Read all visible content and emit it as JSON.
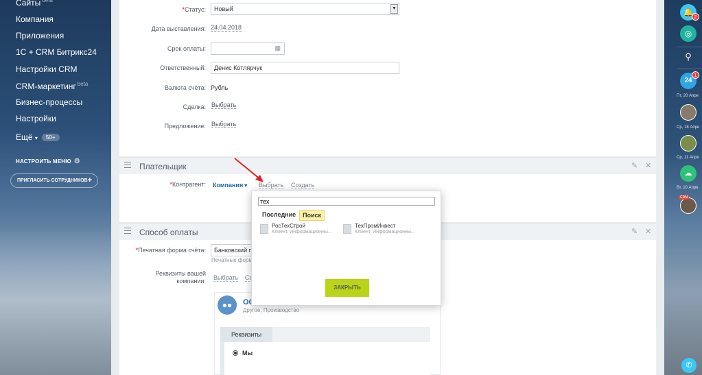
{
  "sidebar": {
    "items": [
      {
        "label": "Сайты",
        "sup": "beta"
      },
      {
        "label": "Компания"
      },
      {
        "label": "Приложения"
      },
      {
        "label": "1С + CRM Битрикс24"
      },
      {
        "label": "Настройки CRM"
      },
      {
        "label": "CRM-маркетинг",
        "sup": "beta"
      },
      {
        "label": "Бизнес-процессы"
      },
      {
        "label": "Настройки"
      },
      {
        "label": "Ещё",
        "badge": "50+"
      }
    ],
    "configure_menu": "НАСТРОИТЬ МЕНЮ",
    "invite": "ПРИГЛАСИТЬ СОТРУДНИКОВ"
  },
  "form": {
    "status_label": "Статус:",
    "status_value": "Новый",
    "date_label": "Дата выставления:",
    "date_value": "24.04.2018",
    "due_label": "Срок оплаты:",
    "due_value": "",
    "responsible_label": "Ответственный:",
    "responsible_value": "Денис Котлярчук",
    "currency_label": "Валюта счёта:",
    "currency_value": "Рубль",
    "deal_label": "Сделка:",
    "deal_link": "Выбрать",
    "offer_label": "Предложение:",
    "offer_link": "Выбрать"
  },
  "payer": {
    "title": "Плательщик",
    "contractor_label": "Контрагент:",
    "company": "Компания",
    "choose": "Выбрать",
    "create": "Создать"
  },
  "payment": {
    "title": "Способ оплаты",
    "print_label": "Печатная форма счёта:",
    "print_value": "Банковский пе",
    "print_hint": "Печатные форм",
    "requisites_label_1": "Реквизиты вашей",
    "requisites_label_2": "компании:",
    "requisites_choose": "Выбрать",
    "requisites_create": "Со"
  },
  "org": {
    "name": "ОО",
    "subtitle": "Другое, Производство",
    "tab": "Реквизиты",
    "radio_label": "Мы"
  },
  "popup": {
    "search_value": "тех",
    "tab_recent": "Последние",
    "tab_search": "Поиск",
    "results": [
      {
        "name": "РосТехСтрой",
        "sub": "Клиент, Информационны..."
      },
      {
        "name": "ТехПромИнвест",
        "sub": "Клиент, Информационны..."
      }
    ],
    "close": "ЗАКРЫТЬ"
  },
  "right_panel": {
    "notify_badge": "2",
    "tasks_badge": "1",
    "dates": [
      "Пт, 20 Апре",
      "Ср, 18 Апре",
      "Ср, 11 Апре",
      "Вт, 10 Апре"
    ],
    "crm_tag": "CRM",
    "counter_24": "24"
  },
  "colors": {
    "accent": "#2067b0",
    "close_btn": "#bbd417",
    "required": "#d0111d",
    "annotation_arrow": "#e52222"
  }
}
